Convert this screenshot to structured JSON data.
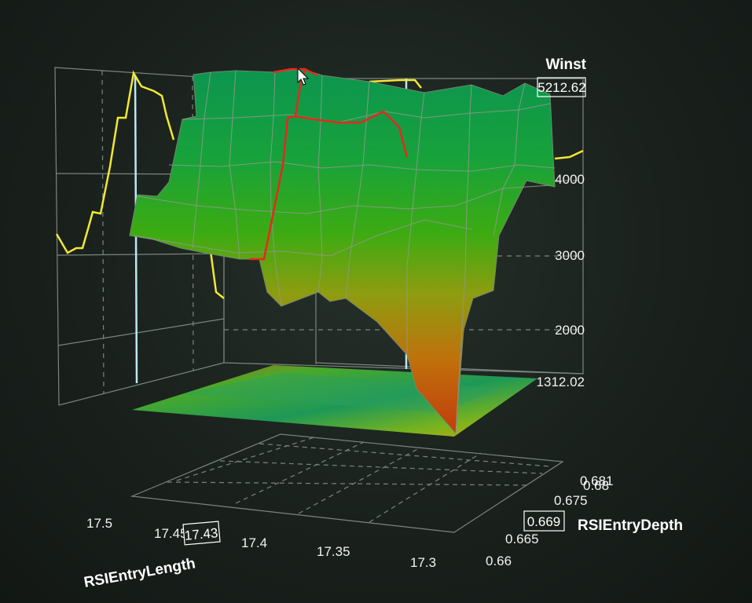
{
  "chart_data": {
    "type": "surface3d",
    "z_axis": {
      "title": "Winst",
      "ticks": [
        "4000",
        "3000",
        "2000"
      ],
      "max_label": "5212.62",
      "min_label": "1312.02",
      "range": [
        1312.02,
        5212.62
      ]
    },
    "x_axis": {
      "title": "RSIEntryLength",
      "ticks": [
        "17.5",
        "17.45",
        "17.4",
        "17.35",
        "17.3"
      ],
      "range": [
        17.3,
        17.5
      ],
      "highlight": "17.43"
    },
    "y_axis": {
      "title": "RSIEntryDepth",
      "ticks": [
        "0.681",
        "0.68",
        "0.675",
        "0.665",
        "0.66"
      ],
      "range": [
        0.66,
        0.681
      ],
      "highlight": "0.669"
    },
    "series_colors": {
      "back_wall_projection": "#f2e832",
      "selected_path": "#e8271e",
      "surface_high": "#0f9a4a",
      "surface_mid": "#3cab10",
      "surface_low": "#c0500b",
      "crosshair": "#bfe7f2"
    },
    "grid": true
  }
}
